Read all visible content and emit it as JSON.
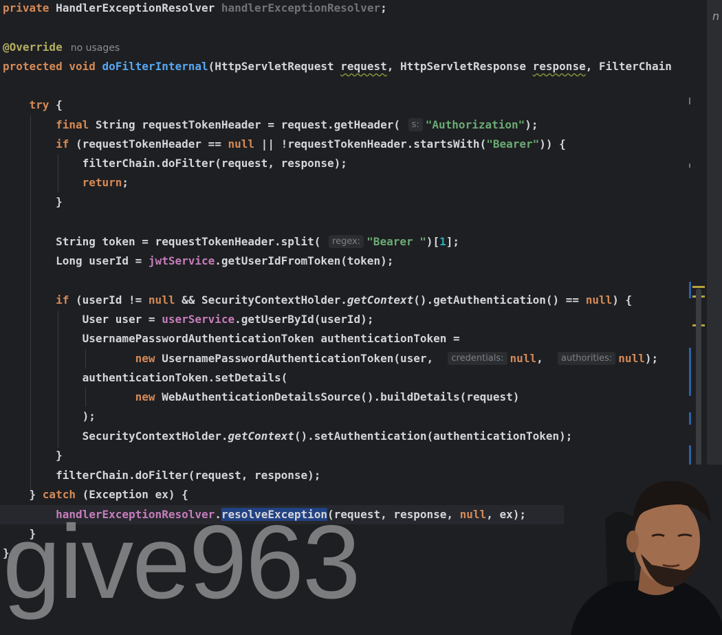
{
  "editor": {
    "lines": [
      {
        "id": "l1",
        "tokens": [
          {
            "t": "private",
            "c": "kw"
          },
          {
            "t": " HandlerExceptionResolver "
          },
          {
            "t": "handlerExceptionResolver",
            "c": "gray"
          },
          {
            "t": ";"
          }
        ]
      },
      {
        "id": "l2",
        "tokens": [
          {
            "t": "@Override",
            "c": "ann"
          },
          {
            "t": "no usages",
            "c": "hint-plain"
          }
        ]
      },
      {
        "id": "l3",
        "tokens": [
          {
            "t": "protected void ",
            "c": "kw"
          },
          {
            "t": "doFilterInternal",
            "c": "fn"
          },
          {
            "t": "(HttpServletRequest "
          },
          {
            "t": "request",
            "c": "squig"
          },
          {
            "t": ", HttpServletResponse "
          },
          {
            "t": "response",
            "c": "squig"
          },
          {
            "t": ", FilterChain"
          }
        ]
      },
      {
        "id": "l4",
        "tokens": [
          {
            "t": "    "
          },
          {
            "t": "try",
            "c": "kw"
          },
          {
            "t": " {"
          }
        ]
      },
      {
        "id": "l5",
        "tokens": [
          {
            "t": "        "
          },
          {
            "t": "final",
            "c": "kw"
          },
          {
            "t": " String requestTokenHeader = request.getHeader( "
          },
          {
            "t": "s:",
            "c": "hint"
          },
          {
            "t": "\"Authorization\"",
            "c": "str"
          },
          {
            "t": ");"
          }
        ]
      },
      {
        "id": "l6",
        "tokens": [
          {
            "t": "        "
          },
          {
            "t": "if",
            "c": "kw"
          },
          {
            "t": " (requestTokenHeader == "
          },
          {
            "t": "null",
            "c": "kw"
          },
          {
            "t": " || !requestTokenHeader.startsWith("
          },
          {
            "t": "\"Bearer\"",
            "c": "str"
          },
          {
            "t": ")) {"
          }
        ]
      },
      {
        "id": "l7",
        "tokens": [
          {
            "t": "            filterChain.doFilter(request, response);"
          }
        ]
      },
      {
        "id": "l8",
        "tokens": [
          {
            "t": "            "
          },
          {
            "t": "return",
            "c": "kw"
          },
          {
            "t": ";"
          }
        ]
      },
      {
        "id": "l9",
        "tokens": [
          {
            "t": "        }"
          }
        ]
      },
      {
        "id": "l10",
        "tokens": [
          {
            "t": "        String token = requestTokenHeader.split( "
          },
          {
            "t": "regex:",
            "c": "hint"
          },
          {
            "t": "\"Bearer \"",
            "c": "str"
          },
          {
            "t": ")["
          },
          {
            "t": "1",
            "c": "num"
          },
          {
            "t": "];"
          }
        ]
      },
      {
        "id": "l11",
        "tokens": [
          {
            "t": "        Long userId = "
          },
          {
            "t": "jwtService",
            "c": "field"
          },
          {
            "t": ".getUserIdFromToken(token);"
          }
        ]
      },
      {
        "id": "l12",
        "tokens": [
          {
            "t": "        "
          },
          {
            "t": "if",
            "c": "kw"
          },
          {
            "t": " (userId != "
          },
          {
            "t": "null",
            "c": "kw"
          },
          {
            "t": " && SecurityContextHolder."
          },
          {
            "t": "getContext",
            "c": "it"
          },
          {
            "t": "().getAuthentication() == "
          },
          {
            "t": "null",
            "c": "kw"
          },
          {
            "t": ") {"
          }
        ]
      },
      {
        "id": "l13",
        "tokens": [
          {
            "t": "            User user = "
          },
          {
            "t": "userService",
            "c": "field"
          },
          {
            "t": ".getUserById(userId);"
          }
        ]
      },
      {
        "id": "l14",
        "tokens": [
          {
            "t": "            UsernamePasswordAuthenticationToken authenticationToken ="
          }
        ]
      },
      {
        "id": "l15",
        "tokens": [
          {
            "t": "                    "
          },
          {
            "t": "new",
            "c": "kw"
          },
          {
            "t": " UsernamePasswordAuthenticationToken(user,  "
          },
          {
            "t": "credentials:",
            "c": "hint"
          },
          {
            "t": "null",
            "c": "kw"
          },
          {
            "t": ",  "
          },
          {
            "t": "authorities:",
            "c": "hint"
          },
          {
            "t": "null",
            "c": "kw"
          },
          {
            "t": ");"
          }
        ]
      },
      {
        "id": "l16",
        "tokens": [
          {
            "t": "            authenticationToken.setDetails("
          }
        ]
      },
      {
        "id": "l17",
        "tokens": [
          {
            "t": "                    "
          },
          {
            "t": "new",
            "c": "kw"
          },
          {
            "t": " WebAuthenticationDetailsSource().buildDetails(request)"
          }
        ]
      },
      {
        "id": "l18",
        "tokens": [
          {
            "t": "            );"
          }
        ]
      },
      {
        "id": "l19",
        "tokens": [
          {
            "t": "            SecurityContextHolder."
          },
          {
            "t": "getContext",
            "c": "it"
          },
          {
            "t": "().setAuthentication(authenticationToken);"
          }
        ]
      },
      {
        "id": "l20",
        "tokens": [
          {
            "t": "        }"
          }
        ]
      },
      {
        "id": "l21",
        "tokens": [
          {
            "t": "        filterChain.doFilter(request, response);"
          }
        ]
      },
      {
        "id": "l22",
        "tokens": [
          {
            "t": "    } "
          },
          {
            "t": "catch",
            "c": "kw"
          },
          {
            "t": " (Exception ex) {"
          }
        ]
      },
      {
        "id": "l23",
        "tokens": [
          {
            "t": "        "
          },
          {
            "t": "handlerExceptionResolver",
            "c": "field"
          },
          {
            "t": "."
          },
          {
            "t": "resolveException",
            "c": "sel"
          },
          {
            "t": "(request, response, "
          },
          {
            "t": "null",
            "c": "kw"
          },
          {
            "t": ", ex);"
          }
        ]
      },
      {
        "id": "l24",
        "tokens": [
          {
            "t": "    }"
          }
        ]
      },
      {
        "id": "l25",
        "tokens": [
          {
            "t": "}"
          }
        ]
      }
    ]
  },
  "right_panel": {
    "corner_text": "n"
  },
  "watermark": {
    "text": "give963"
  },
  "webcam": {
    "icon": "person-webcam"
  }
}
